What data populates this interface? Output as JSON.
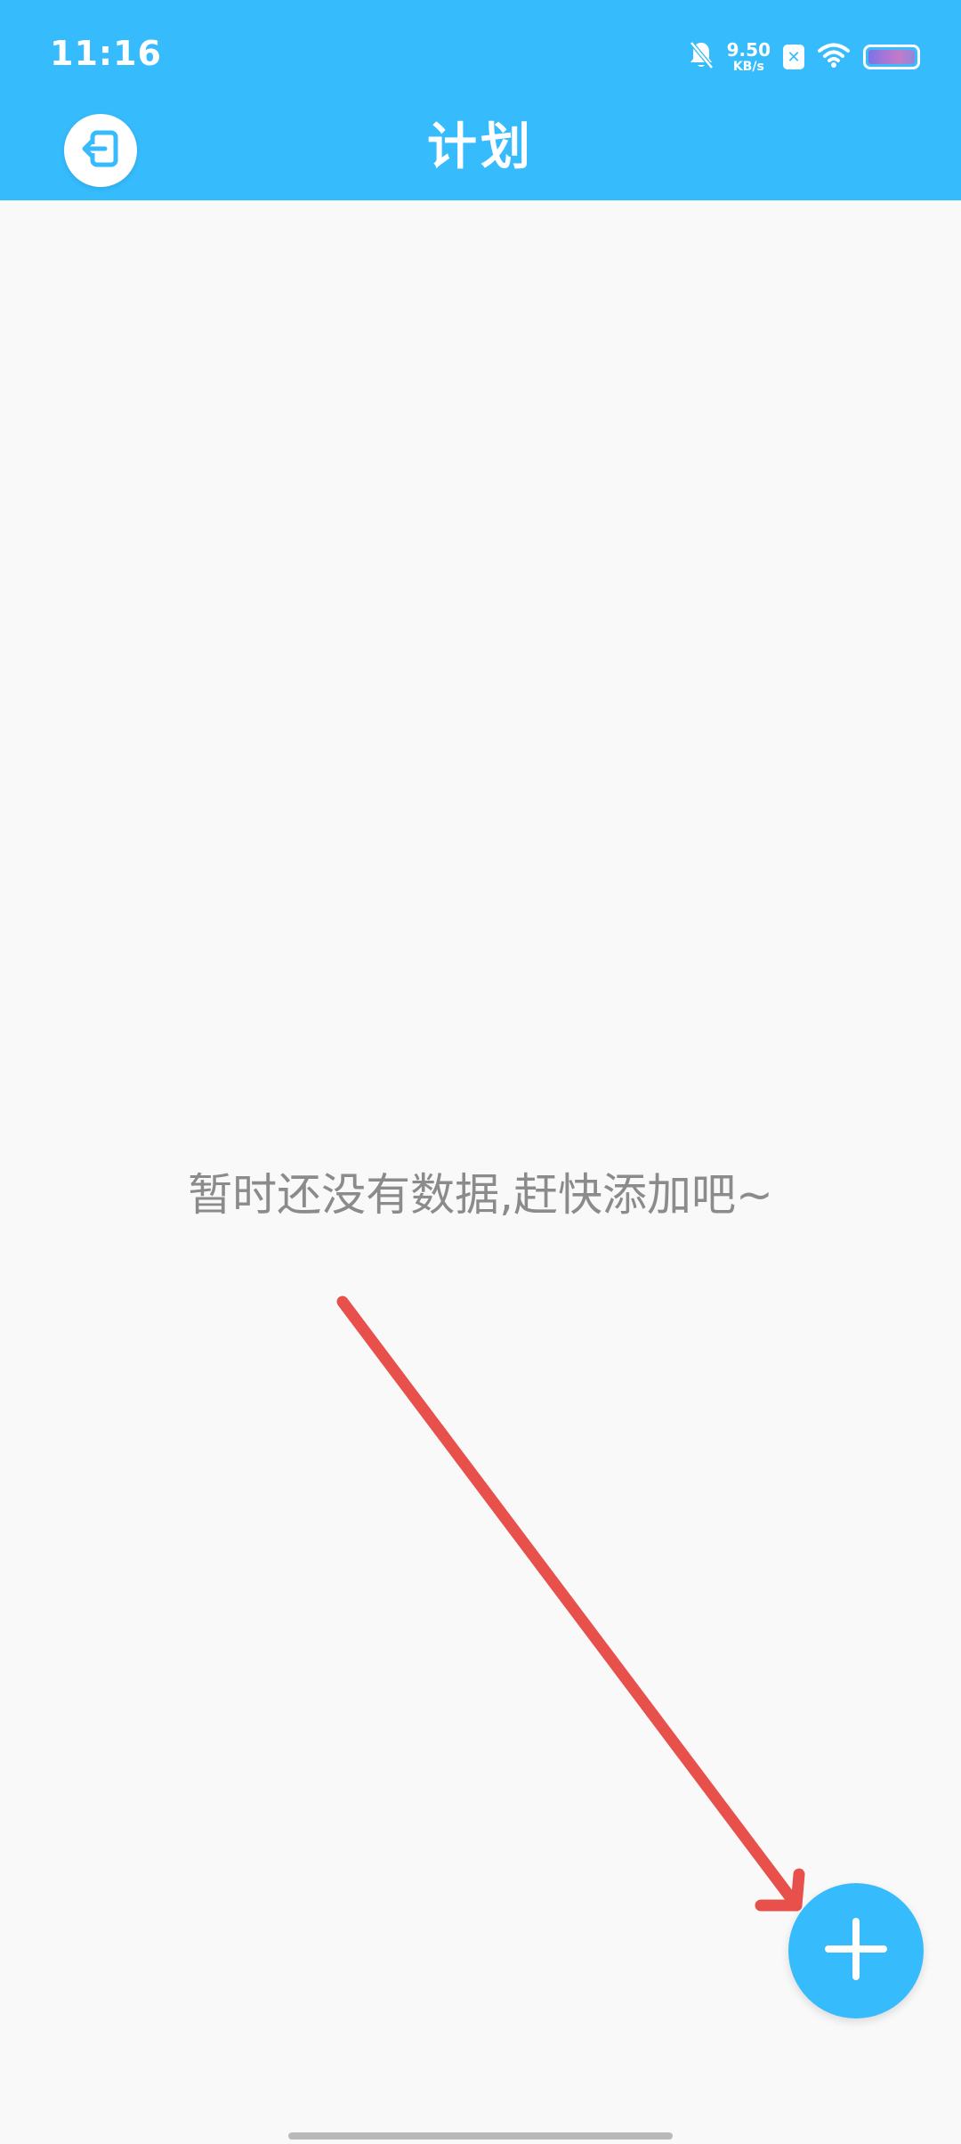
{
  "status_bar": {
    "time": "11:16",
    "net_speed_value": "9.50",
    "net_speed_unit": "KB/s",
    "sim_badge": "✕",
    "icons": [
      "bell-off-icon",
      "sim-blocked-icon",
      "wifi-icon",
      "battery-icon"
    ]
  },
  "header": {
    "title": "计划",
    "back_icon": "logout-icon"
  },
  "main": {
    "empty_message": "暂时还没有数据,赶快添加吧~"
  },
  "fab": {
    "icon": "plus-icon"
  },
  "annotation": {
    "icon": "red-arrow-icon"
  },
  "colors": {
    "primary": "#36bbfd",
    "background": "#f9f9fa",
    "empty_text": "#8b8b8b",
    "annotation_arrow": "#e8504b"
  }
}
